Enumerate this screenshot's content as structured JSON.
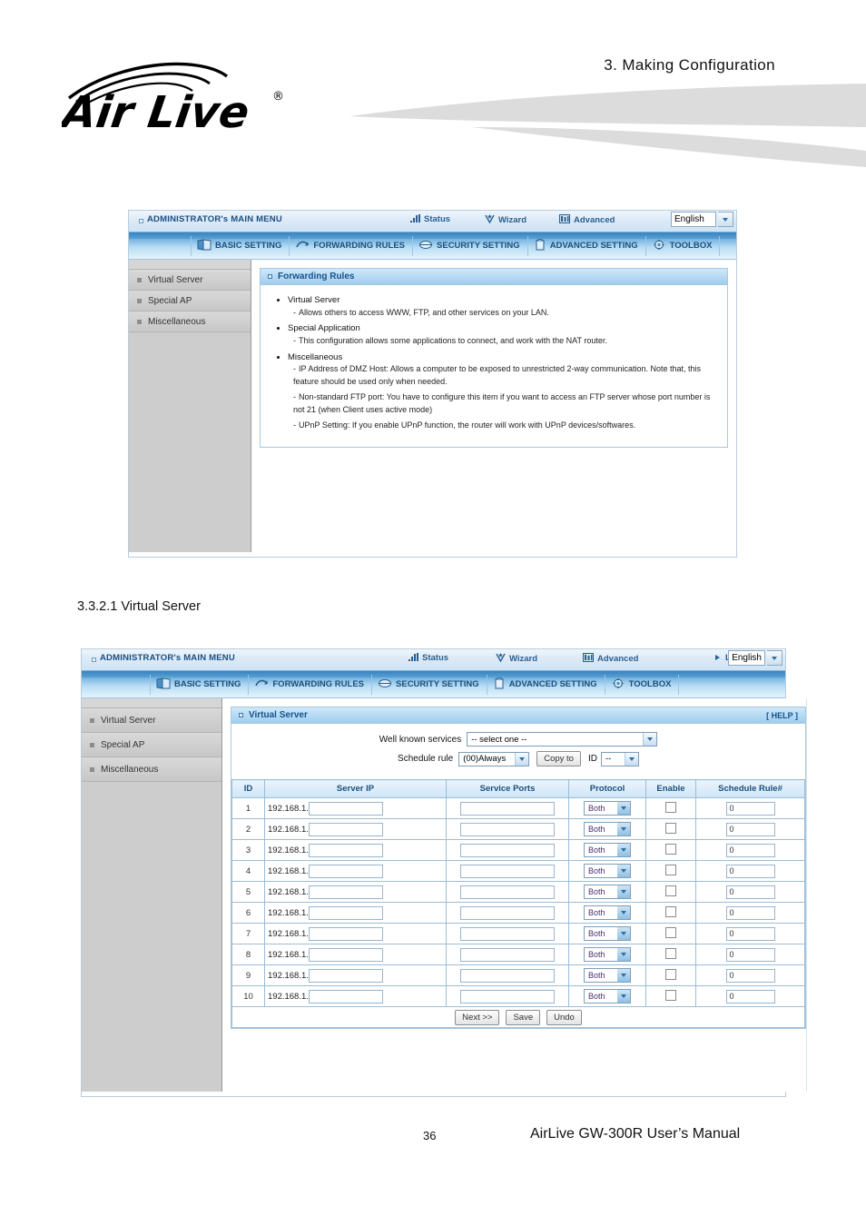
{
  "header": {
    "chapter_title": "3.  Making  Configuration",
    "logo_text": "Air Live",
    "logo_trademark": "®"
  },
  "section_heading": "3.3.2.1 Virtual Server",
  "footer": {
    "page_number": "36",
    "manual_title": "AirLive GW-300R User’s Manual"
  },
  "router_ui": {
    "topbar": {
      "admin_menu": "ADMINISTRATOR's MAIN MENU",
      "items": [
        {
          "label": "Status",
          "icon": "status-bars-icon"
        },
        {
          "label": "Wizard",
          "icon": "wizard-wand-icon"
        },
        {
          "label": "Advanced",
          "icon": "advanced-panel-icon"
        },
        {
          "label": "Logout",
          "icon": "arrow-right-icon"
        }
      ],
      "language": "English"
    },
    "nav_tabs": [
      {
        "label": "BASIC SETTING",
        "icon": "book-icon",
        "active": false
      },
      {
        "label": "FORWARDING RULES",
        "icon": "arrows-icon",
        "active": true
      },
      {
        "label": "SECURITY SETTING",
        "icon": "shield-icon",
        "active": false
      },
      {
        "label": "ADVANCED SETTING",
        "icon": "tower-icon",
        "active": false
      },
      {
        "label": "TOOLBOX",
        "icon": "gear-icon",
        "active": false
      }
    ],
    "sidebar": [
      {
        "label": "Virtual Server"
      },
      {
        "label": "Special AP"
      },
      {
        "label": "Miscellaneous"
      }
    ]
  },
  "screen1": {
    "panel_title": "Forwarding Rules",
    "entries": [
      {
        "title": "Virtual Server",
        "lines": [
          "Allows others to access WWW, FTP, and other services on your LAN."
        ]
      },
      {
        "title": "Special Application",
        "lines": [
          "This configuration allows some applications to connect, and work with the NAT router."
        ]
      },
      {
        "title": "Miscellaneous",
        "lines": [
          "IP Address of DMZ Host: Allows a computer to be exposed to unrestricted 2-way communication. Note that, this feature should be used only when needed.",
          "Non-standard FTP port: You have to configure this item if you want to access an FTP server whose port number is not 21 (when Client uses active mode)",
          "UPnP Setting: If you enable UPnP function, the router will work with UPnP devices/softwares."
        ]
      }
    ]
  },
  "screen2": {
    "panel_title": "Virtual Server",
    "help_label": "[ HELP ]",
    "form": {
      "well_known_label": "Well known services",
      "well_known_value": "-- select one --",
      "schedule_label": "Schedule rule",
      "schedule_value": "(00)Always",
      "copy_to_label": "Copy to",
      "id_label": "ID",
      "id_value": "--"
    },
    "table": {
      "columns": [
        "ID",
        "Server IP",
        "Service Ports",
        "Protocol",
        "Enable",
        "Schedule Rule#"
      ],
      "ip_prefix": "192.168.1.",
      "rows": [
        {
          "id": "1",
          "server_ip": "",
          "service_ports": "",
          "protocol": "Both",
          "enable": false,
          "schedule_rule": "0"
        },
        {
          "id": "2",
          "server_ip": "",
          "service_ports": "",
          "protocol": "Both",
          "enable": false,
          "schedule_rule": "0"
        },
        {
          "id": "3",
          "server_ip": "",
          "service_ports": "",
          "protocol": "Both",
          "enable": false,
          "schedule_rule": "0"
        },
        {
          "id": "4",
          "server_ip": "",
          "service_ports": "",
          "protocol": "Both",
          "enable": false,
          "schedule_rule": "0"
        },
        {
          "id": "5",
          "server_ip": "",
          "service_ports": "",
          "protocol": "Both",
          "enable": false,
          "schedule_rule": "0"
        },
        {
          "id": "6",
          "server_ip": "",
          "service_ports": "",
          "protocol": "Both",
          "enable": false,
          "schedule_rule": "0"
        },
        {
          "id": "7",
          "server_ip": "",
          "service_ports": "",
          "protocol": "Both",
          "enable": false,
          "schedule_rule": "0"
        },
        {
          "id": "8",
          "server_ip": "",
          "service_ports": "",
          "protocol": "Both",
          "enable": false,
          "schedule_rule": "0"
        },
        {
          "id": "9",
          "server_ip": "",
          "service_ports": "",
          "protocol": "Both",
          "enable": false,
          "schedule_rule": "0"
        },
        {
          "id": "10",
          "server_ip": "",
          "service_ports": "",
          "protocol": "Both",
          "enable": false,
          "schedule_rule": "0"
        }
      ]
    },
    "buttons": [
      {
        "label": "Next >>"
      },
      {
        "label": "Save"
      },
      {
        "label": "Undo"
      }
    ]
  },
  "colors": {
    "accent_blue": "#1b4f7e",
    "panel_header": "#9fcdee",
    "sidebar_gray": "#cdcdcd",
    "swoosh_gray": "#dcdcdc"
  }
}
